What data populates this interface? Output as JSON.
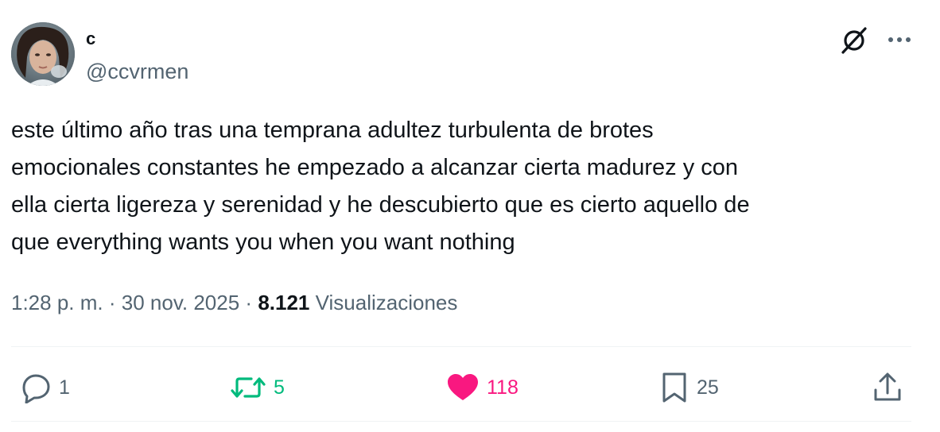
{
  "author": {
    "display_name": "c",
    "handle": "@ccvrmen"
  },
  "tweet": {
    "text": "este último año tras una temprana adultez turbulenta de brotes\nemocionales constantes he empezado a alcanzar cierta madurez y con\nella cierta ligereza y serenidad y he descubierto que es cierto aquello de\nque everything wants you when you want nothing",
    "time": "1:28 p. m.",
    "separator": "·",
    "date": "30 nov. 2025",
    "views_count": "8.121",
    "views_label": "Visualizaciones"
  },
  "actions": {
    "replies": "1",
    "reposts": "5",
    "likes": "118",
    "bookmarks": "25"
  },
  "icons": {
    "grok": "slash-circle-icon",
    "more": "more-icon",
    "reply": "reply-icon",
    "repost": "repost-icon",
    "like": "heart-icon",
    "bookmark": "bookmark-icon",
    "share": "share-icon"
  },
  "colors": {
    "text": "#0f1419",
    "secondary": "#536471",
    "repost": "#00ba7c",
    "like": "#f91880",
    "divider": "#eff3f4"
  }
}
